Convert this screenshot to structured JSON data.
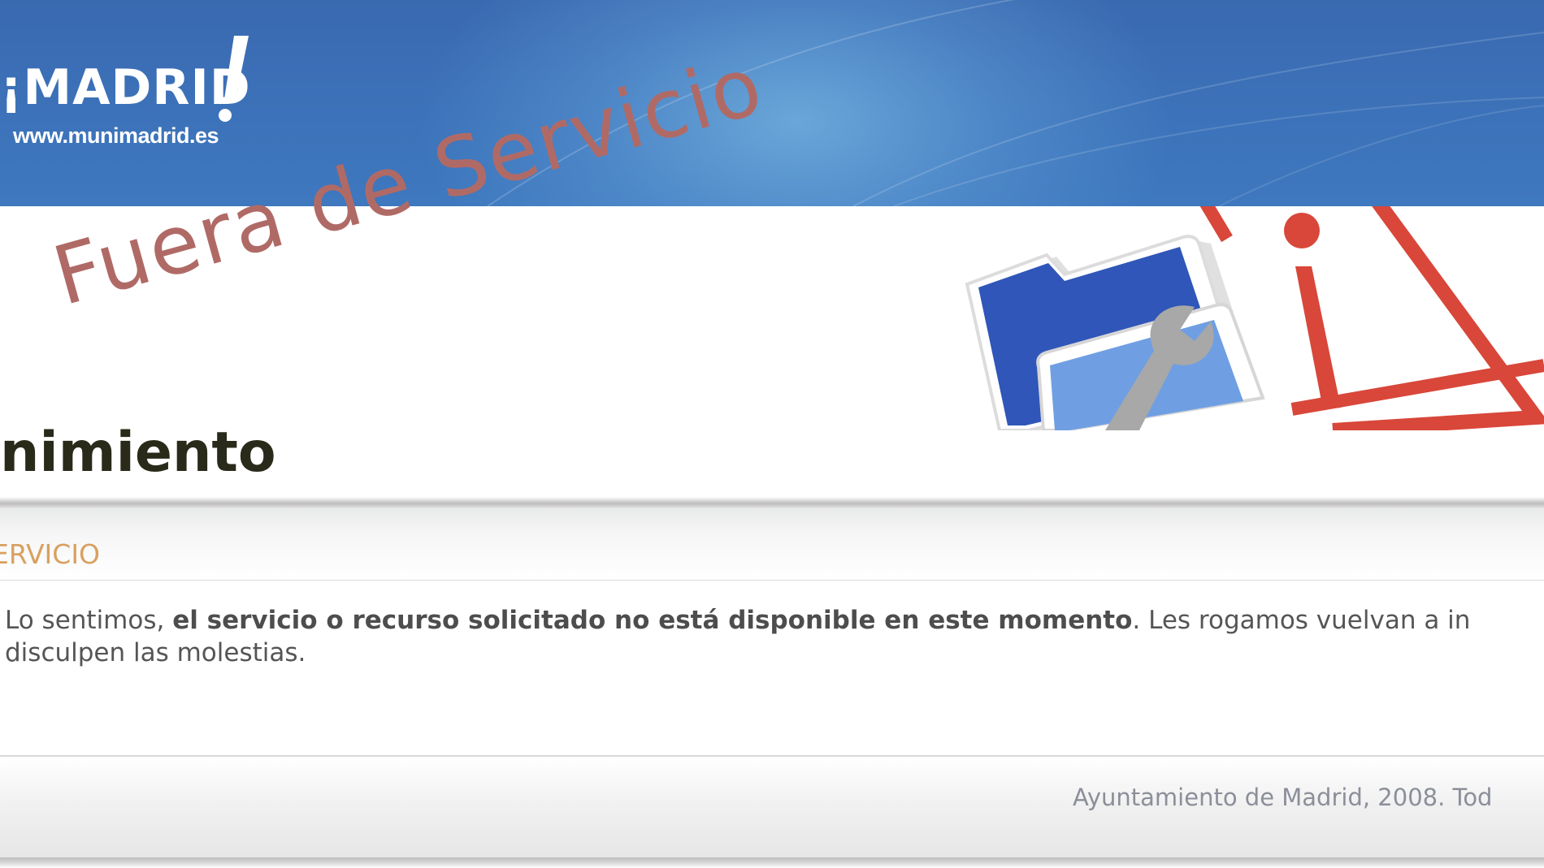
{
  "header": {
    "logo_text": "¡MADRID",
    "logo_url": "www.munimadrid.es",
    "colors": {
      "header_blue": "#3a6cb3",
      "logo_white": "#ffffff"
    }
  },
  "banner": {
    "headline": "Fuera de Servicio",
    "page_title": "nimiento",
    "art_icons": [
      "folder-wrench-icon",
      "warning-triangle-icon"
    ],
    "colors": {
      "headline": "#b06a66",
      "warning_red": "#d8473a",
      "folder_blue": "#3a5fbf"
    }
  },
  "section": {
    "title": "ERVICIO",
    "title_color": "#d9a060"
  },
  "message": {
    "part1": "Lo sentimos, ",
    "part2_bold": "el servicio o recurso solicitado no está disponible en este momento",
    "part3": ". Les rogamos vuelvan a in",
    "line2": "disculpen las molestias."
  },
  "footer": {
    "text": "Ayuntamiento de Madrid, 2008. Tod"
  }
}
